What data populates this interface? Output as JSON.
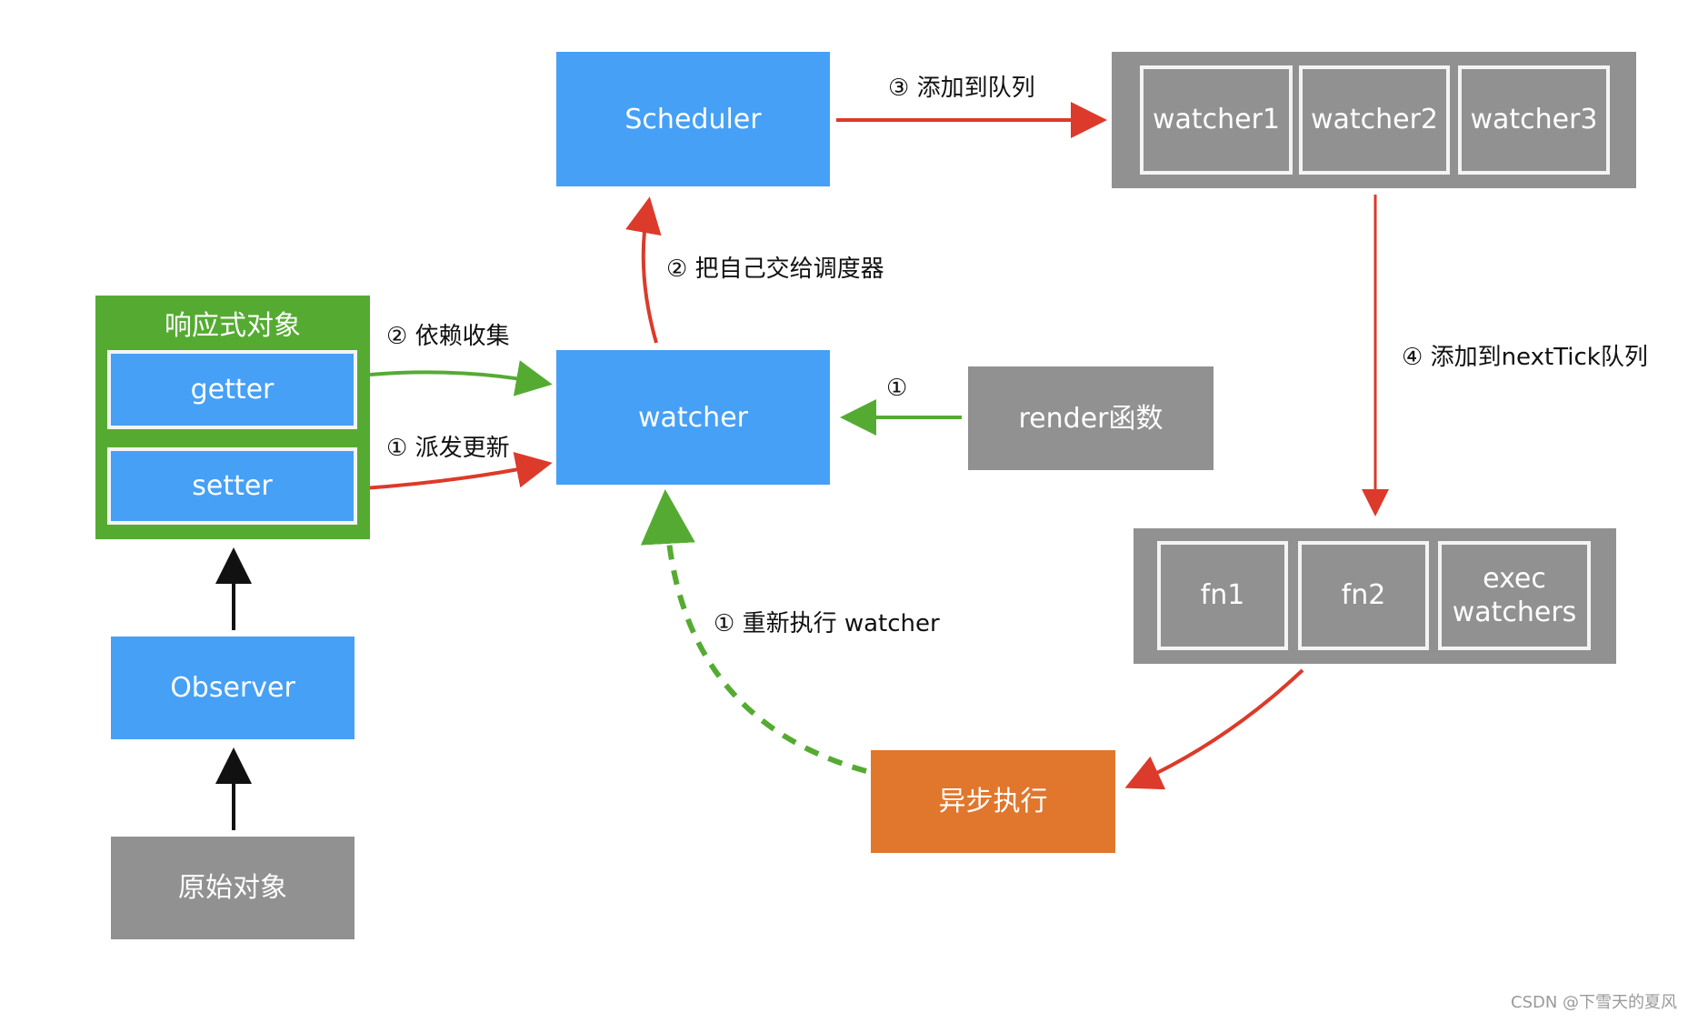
{
  "nodes": {
    "scheduler": "Scheduler",
    "watcher": "watcher",
    "reactive_object": {
      "title": "响应式对象",
      "getter": "getter",
      "setter": "setter"
    },
    "observer": "Observer",
    "raw_object": "原始对象",
    "render_fn": "render函数",
    "async_exec": "异步执行",
    "watcher_queue": [
      "watcher1",
      "watcher2",
      "watcher3"
    ],
    "next_tick_queue": [
      "fn1",
      "fn2",
      "exec watchers"
    ]
  },
  "edges": {
    "dep_collect": "② 依赖收集",
    "notify": "① 派发更新",
    "to_scheduler": "② 把自己交给调度器",
    "add_queue": "③ 添加到队列",
    "render_to_watcher": "①",
    "add_next_tick": "④ 添加到nextTick队列",
    "rerun_watcher": "① 重新执行 watcher"
  },
  "colors": {
    "blue": "#46a0f5",
    "green": "#55ab32",
    "gray": "#919191",
    "orange": "#e1762d",
    "red": "#dc3a2a",
    "black": "#111111"
  },
  "watermark": "CSDN @下雪天的夏风"
}
